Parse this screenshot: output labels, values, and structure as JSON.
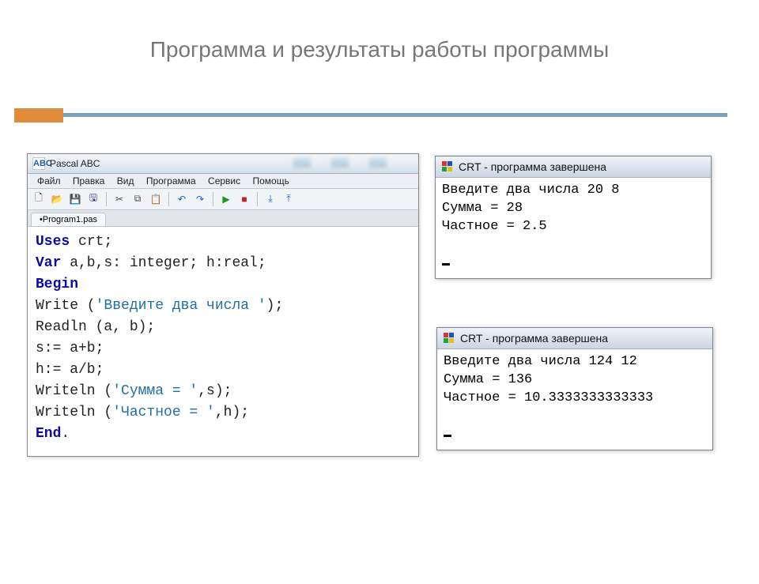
{
  "slide": {
    "title": "Программа и результаты работы программы"
  },
  "ide": {
    "window_title": "Pascal ABC",
    "app_icon_text": "ABC",
    "menu": [
      "Файл",
      "Правка",
      "Вид",
      "Программа",
      "Сервис",
      "Помощь"
    ],
    "tab": "•Program1.pas",
    "code_lines": [
      {
        "t": "kw",
        "txt": "Uses"
      },
      {
        "t": "",
        "txt": " crt;"
      },
      {
        "t": "br"
      },
      {
        "t": "kw",
        "txt": "Var"
      },
      {
        "t": "",
        "txt": " a,b,s: integer; h:real;"
      },
      {
        "t": "br"
      },
      {
        "t": "kw",
        "txt": "Begin"
      },
      {
        "t": "br"
      },
      {
        "t": "",
        "txt": "Write ("
      },
      {
        "t": "st",
        "txt": "'Введите два числа '"
      },
      {
        "t": "",
        "txt": ");"
      },
      {
        "t": "br"
      },
      {
        "t": "",
        "txt": "Readln (a, b);"
      },
      {
        "t": "br"
      },
      {
        "t": "",
        "txt": "s:= a+b;"
      },
      {
        "t": "br"
      },
      {
        "t": "",
        "txt": "h:= a/b;"
      },
      {
        "t": "br"
      },
      {
        "t": "",
        "txt": "Writeln ("
      },
      {
        "t": "st",
        "txt": "'Сумма = '"
      },
      {
        "t": "",
        "txt": ",s);"
      },
      {
        "t": "br"
      },
      {
        "t": "",
        "txt": "Writeln ("
      },
      {
        "t": "st",
        "txt": "'Частное = '"
      },
      {
        "t": "",
        "txt": ",h);"
      },
      {
        "t": "br"
      },
      {
        "t": "kw",
        "txt": "End"
      },
      {
        "t": "",
        "txt": "."
      }
    ]
  },
  "crt1": {
    "title": "CRT - программа завершена",
    "lines": [
      "Введите два числа 20 8",
      "Сумма = 28",
      "Частное = 2.5"
    ]
  },
  "crt2": {
    "title": "CRT - программа завершена",
    "lines": [
      "Введите два числа 124 12",
      "Сумма = 136",
      "Частное = 10.3333333333333"
    ]
  },
  "toolbar_icons": {
    "new": "🗋",
    "open": "📂",
    "save": "💾",
    "saveall": "🖫",
    "cut": "✂",
    "copy": "⧉",
    "paste": "📋",
    "undo": "↶",
    "redo": "↷",
    "run": "▶",
    "stop": "■",
    "step": "⤓",
    "step2": "⤒"
  }
}
